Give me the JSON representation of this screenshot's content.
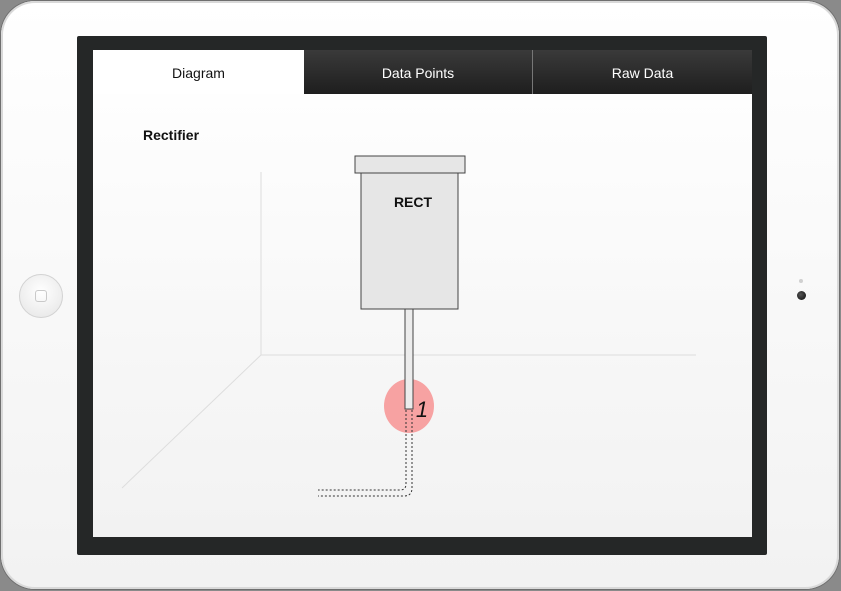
{
  "tabs": [
    {
      "label": "Diagram",
      "active": true
    },
    {
      "label": "Data Points",
      "active": false
    },
    {
      "label": "Raw Data",
      "active": false
    }
  ],
  "diagram": {
    "title": "Rectifier",
    "component_label": "RECT",
    "data_point_label": "1",
    "data_point_color": "#f7a2a2"
  }
}
